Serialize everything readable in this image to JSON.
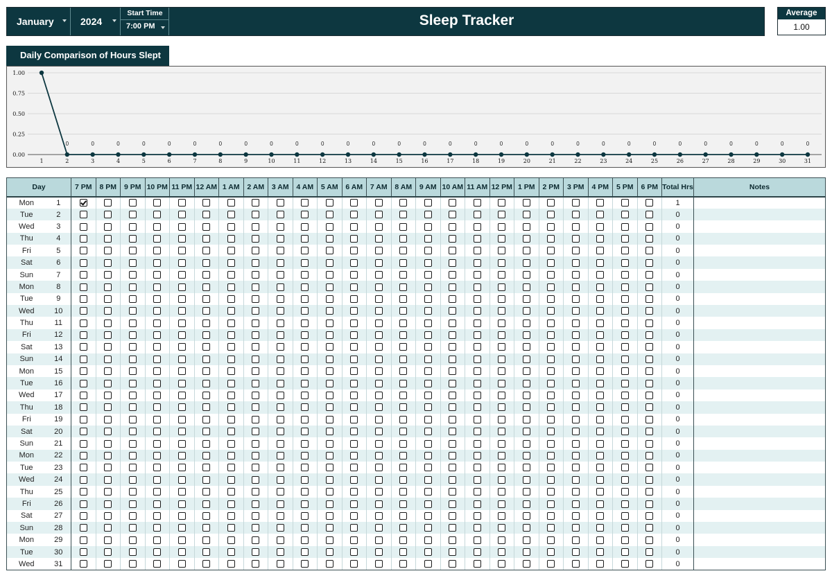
{
  "header": {
    "month": "January",
    "year": "2024",
    "start_time_label": "Start Time",
    "start_time": "7:00 PM",
    "title": "Sleep Tracker",
    "average_label": "Average",
    "average_value": "1.00"
  },
  "chart_tab": "Daily Comparison of Hours Slept",
  "chart_data": {
    "type": "line",
    "title": "Daily Comparison of Hours Slept",
    "x": [
      1,
      2,
      3,
      4,
      5,
      6,
      7,
      8,
      9,
      10,
      11,
      12,
      13,
      14,
      15,
      16,
      17,
      18,
      19,
      20,
      21,
      22,
      23,
      24,
      25,
      26,
      27,
      28,
      29,
      30,
      31
    ],
    "series": [
      {
        "values": [
          1,
          0,
          0,
          0,
          0,
          0,
          0,
          0,
          0,
          0,
          0,
          0,
          0,
          0,
          0,
          0,
          0,
          0,
          0,
          0,
          0,
          0,
          0,
          0,
          0,
          0,
          0,
          0,
          0,
          0,
          0
        ]
      }
    ],
    "y_ticks": [
      "0.00",
      "0.25",
      "0.50",
      "0.75",
      "1.00"
    ],
    "ylim": [
      0,
      1
    ],
    "data_labels": "0",
    "grid": true,
    "color": "#0d3740"
  },
  "table": {
    "day_header": "Day",
    "hours": [
      "7 PM",
      "8 PM",
      "9 PM",
      "10 PM",
      "11 PM",
      "12 AM",
      "1 AM",
      "2 AM",
      "3 AM",
      "4 AM",
      "5 AM",
      "6 AM",
      "7 AM",
      "8 AM",
      "9 AM",
      "10 AM",
      "11 AM",
      "12 PM",
      "1 PM",
      "2 PM",
      "3 PM",
      "4 PM",
      "5 PM",
      "6 PM"
    ],
    "total_header": "Total Hrs",
    "notes_header": "Notes",
    "rows": [
      {
        "day": "Mon",
        "num": "1",
        "checked": [
          0
        ],
        "total": "1"
      },
      {
        "day": "Tue",
        "num": "2",
        "checked": [],
        "total": "0"
      },
      {
        "day": "Wed",
        "num": "3",
        "checked": [],
        "total": "0"
      },
      {
        "day": "Thu",
        "num": "4",
        "checked": [],
        "total": "0"
      },
      {
        "day": "Fri",
        "num": "5",
        "checked": [],
        "total": "0"
      },
      {
        "day": "Sat",
        "num": "6",
        "checked": [],
        "total": "0"
      },
      {
        "day": "Sun",
        "num": "7",
        "checked": [],
        "total": "0"
      },
      {
        "day": "Mon",
        "num": "8",
        "checked": [],
        "total": "0"
      },
      {
        "day": "Tue",
        "num": "9",
        "checked": [],
        "total": "0"
      },
      {
        "day": "Wed",
        "num": "10",
        "checked": [],
        "total": "0"
      },
      {
        "day": "Thu",
        "num": "11",
        "checked": [],
        "total": "0"
      },
      {
        "day": "Fri",
        "num": "12",
        "checked": [],
        "total": "0"
      },
      {
        "day": "Sat",
        "num": "13",
        "checked": [],
        "total": "0"
      },
      {
        "day": "Sun",
        "num": "14",
        "checked": [],
        "total": "0"
      },
      {
        "day": "Mon",
        "num": "15",
        "checked": [],
        "total": "0"
      },
      {
        "day": "Tue",
        "num": "16",
        "checked": [],
        "total": "0"
      },
      {
        "day": "Wed",
        "num": "17",
        "checked": [],
        "total": "0"
      },
      {
        "day": "Thu",
        "num": "18",
        "checked": [],
        "total": "0"
      },
      {
        "day": "Fri",
        "num": "19",
        "checked": [],
        "total": "0"
      },
      {
        "day": "Sat",
        "num": "20",
        "checked": [],
        "total": "0"
      },
      {
        "day": "Sun",
        "num": "21",
        "checked": [],
        "total": "0"
      },
      {
        "day": "Mon",
        "num": "22",
        "checked": [],
        "total": "0"
      },
      {
        "day": "Tue",
        "num": "23",
        "checked": [],
        "total": "0"
      },
      {
        "day": "Wed",
        "num": "24",
        "checked": [],
        "total": "0"
      },
      {
        "day": "Thu",
        "num": "25",
        "checked": [],
        "total": "0"
      },
      {
        "day": "Fri",
        "num": "26",
        "checked": [],
        "total": "0"
      },
      {
        "day": "Sat",
        "num": "27",
        "checked": [],
        "total": "0"
      },
      {
        "day": "Sun",
        "num": "28",
        "checked": [],
        "total": "0"
      },
      {
        "day": "Mon",
        "num": "29",
        "checked": [],
        "total": "0"
      },
      {
        "day": "Tue",
        "num": "30",
        "checked": [],
        "total": "0"
      },
      {
        "day": "Wed",
        "num": "31",
        "checked": [],
        "total": "0"
      }
    ]
  }
}
